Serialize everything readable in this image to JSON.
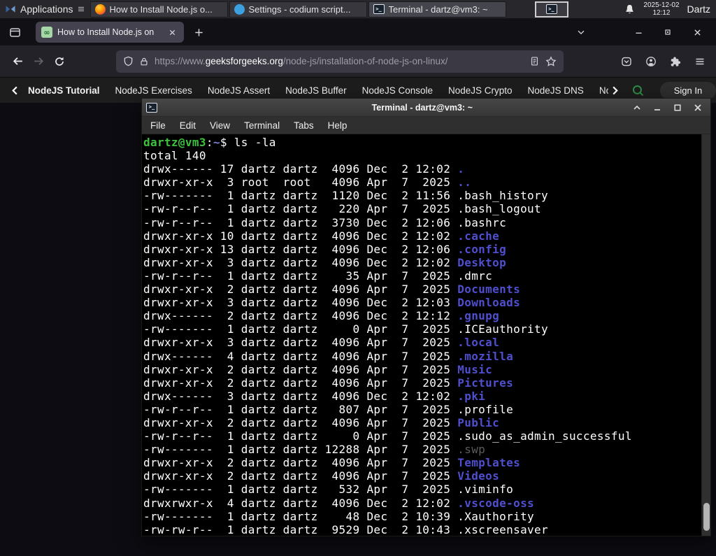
{
  "panel": {
    "applications_label": "Applications",
    "windows": [
      {
        "icon": "firefox",
        "title": "How to Install Node.js o..."
      },
      {
        "icon": "vscodium",
        "title": "Settings - codium script..."
      },
      {
        "icon": "terminal",
        "title": "Terminal - dartz@vm3: ~",
        "active": true
      }
    ],
    "clock_date": "2025-12-02",
    "clock_time": "12:12",
    "user": "Dartz"
  },
  "browser": {
    "tab_title": "How to Install Node.js on",
    "url_scheme_sub": "https://www.",
    "url_domain": "geeksforgeeks.org",
    "url_path": "/node-js/installation-of-node-js-on-linux/"
  },
  "gfg_nav": {
    "links": [
      "NodeJS Tutorial",
      "NodeJS Exercises",
      "NodeJS Assert",
      "NodeJS Buffer",
      "NodeJS Console",
      "NodeJS Crypto",
      "NodeJS DNS",
      "Node"
    ],
    "sign_in_label": "Sign In"
  },
  "icons": {
    "terminal_glyph": ">_",
    "gfg_glyph": "∞",
    "vscodium_glyph": "V"
  },
  "colors": {
    "prompt_green": "#3ec23e",
    "dir_blue": "#4f4fd0",
    "dim_gray": "#5c5c5c",
    "gfg_green": "#2f8d46"
  },
  "terminal_window": {
    "title": "Terminal - dartz@vm3: ~",
    "menus": [
      "File",
      "Edit",
      "View",
      "Terminal",
      "Tabs",
      "Help"
    ],
    "lines": [
      [
        [
          "dartz@vm3",
          "u"
        ],
        [
          ":",
          "p"
        ],
        [
          "~",
          "t"
        ],
        [
          "$ ls -la",
          "p"
        ]
      ],
      [
        [
          "total 140",
          "p"
        ]
      ],
      [
        [
          "drwx------ 17 dartz dartz  4096 Dec  2 12:02 ",
          "p"
        ],
        [
          ".",
          "d"
        ]
      ],
      [
        [
          "drwxr-xr-x  3 root  root   4096 Apr  7  2025 ",
          "p"
        ],
        [
          "..",
          "d"
        ]
      ],
      [
        [
          "-rw-------  1 dartz dartz  1120 Dec  2 11:56 .bash_history",
          "p"
        ]
      ],
      [
        [
          "-rw-r--r--  1 dartz dartz   220 Apr  7  2025 .bash_logout",
          "p"
        ]
      ],
      [
        [
          "-rw-r--r--  1 dartz dartz  3730 Dec  2 12:06 .bashrc",
          "p"
        ]
      ],
      [
        [
          "drwxr-xr-x 10 dartz dartz  4096 Dec  2 12:02 ",
          "p"
        ],
        [
          ".cache",
          "d"
        ]
      ],
      [
        [
          "drwxr-xr-x 13 dartz dartz  4096 Dec  2 12:06 ",
          "p"
        ],
        [
          ".config",
          "d"
        ]
      ],
      [
        [
          "drwxr-xr-x  3 dartz dartz  4096 Dec  2 12:02 ",
          "p"
        ],
        [
          "Desktop",
          "d"
        ]
      ],
      [
        [
          "-rw-r--r--  1 dartz dartz    35 Apr  7  2025 .dmrc",
          "p"
        ]
      ],
      [
        [
          "drwxr-xr-x  2 dartz dartz  4096 Apr  7  2025 ",
          "p"
        ],
        [
          "Documents",
          "d"
        ]
      ],
      [
        [
          "drwxr-xr-x  3 dartz dartz  4096 Dec  2 12:03 ",
          "p"
        ],
        [
          "Downloads",
          "d"
        ]
      ],
      [
        [
          "drwx------  2 dartz dartz  4096 Dec  2 12:12 ",
          "p"
        ],
        [
          ".gnupg",
          "d"
        ]
      ],
      [
        [
          "-rw-------  1 dartz dartz     0 Apr  7  2025 .ICEauthority",
          "p"
        ]
      ],
      [
        [
          "drwxr-xr-x  3 dartz dartz  4096 Apr  7  2025 ",
          "p"
        ],
        [
          ".local",
          "d"
        ]
      ],
      [
        [
          "drwx------  4 dartz dartz  4096 Apr  7  2025 ",
          "p"
        ],
        [
          ".mozilla",
          "d"
        ]
      ],
      [
        [
          "drwxr-xr-x  2 dartz dartz  4096 Apr  7  2025 ",
          "p"
        ],
        [
          "Music",
          "d"
        ]
      ],
      [
        [
          "drwxr-xr-x  2 dartz dartz  4096 Apr  7  2025 ",
          "p"
        ],
        [
          "Pictures",
          "d"
        ]
      ],
      [
        [
          "drwx------  3 dartz dartz  4096 Dec  2 12:02 ",
          "p"
        ],
        [
          ".pki",
          "d"
        ]
      ],
      [
        [
          "-rw-r--r--  1 dartz dartz   807 Apr  7  2025 .profile",
          "p"
        ]
      ],
      [
        [
          "drwxr-xr-x  2 dartz dartz  4096 Apr  7  2025 ",
          "p"
        ],
        [
          "Public",
          "d"
        ]
      ],
      [
        [
          "-rw-r--r--  1 dartz dartz     0 Apr  7  2025 .sudo_as_admin_successful",
          "p"
        ]
      ],
      [
        [
          "-rw-------  1 dartz dartz 12288 Apr  7  2025 ",
          "p"
        ],
        [
          ".swp",
          "m"
        ]
      ],
      [
        [
          "drwxr-xr-x  2 dartz dartz  4096 Apr  7  2025 ",
          "p"
        ],
        [
          "Templates",
          "d"
        ]
      ],
      [
        [
          "drwxr-xr-x  2 dartz dartz  4096 Apr  7  2025 ",
          "p"
        ],
        [
          "Videos",
          "d"
        ]
      ],
      [
        [
          "-rw-------  1 dartz dartz   532 Apr  7  2025 .viminfo",
          "p"
        ]
      ],
      [
        [
          "drwxrwxr-x  4 dartz dartz  4096 Dec  2 12:02 ",
          "p"
        ],
        [
          ".vscode-oss",
          "d"
        ]
      ],
      [
        [
          "-rw-------  1 dartz dartz    48 Dec  2 10:39 .Xauthority",
          "p"
        ]
      ],
      [
        [
          "-rw-rw-r--  1 dartz dartz  9529 Dec  2 10:43 .xscreensaver",
          "p"
        ]
      ]
    ]
  }
}
